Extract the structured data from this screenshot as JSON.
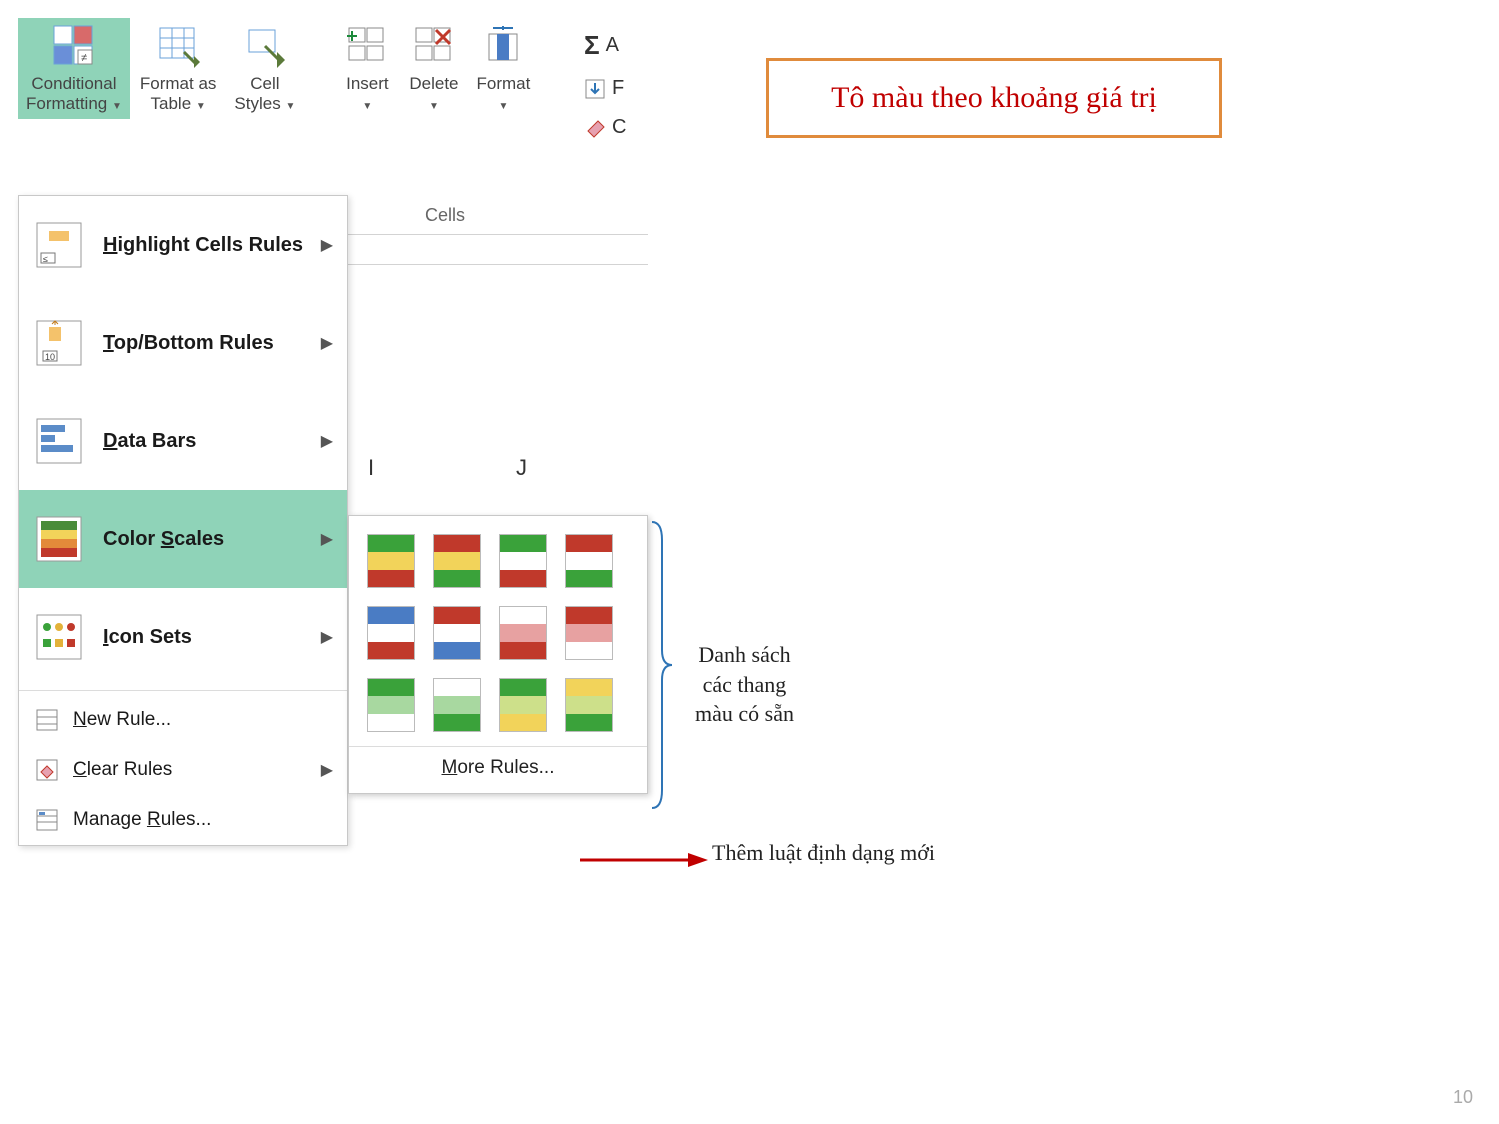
{
  "ribbon": {
    "conditional": "Conditional\nFormatting",
    "formatAs": "Format as\nTable",
    "cellStyles": "Cell\nStyles",
    "insert": "Insert",
    "delete": "Delete",
    "format": "Format",
    "cells": "Cells",
    "edit": {
      "a": "A",
      "f": "F",
      "c": "C"
    }
  },
  "menu": {
    "highlight": "Highlight Cells Rules",
    "topbottom": "Top/Bottom Rules",
    "databars": "Data Bars",
    "colorscales": "Color Scales",
    "iconsets": "Icon Sets",
    "newrule": "New Rule...",
    "clear": "Clear Rules",
    "manage": "Manage Rules..."
  },
  "submenu": {
    "more": "More Rules..."
  },
  "columns": {
    "i": "I",
    "j": "J"
  },
  "callout": "Tô màu theo khoảng giá trị",
  "note_scales": "Danh sách\ncác thang\nmàu có sẵn",
  "note_more": "Thêm luật định dạng mới",
  "page": "10"
}
